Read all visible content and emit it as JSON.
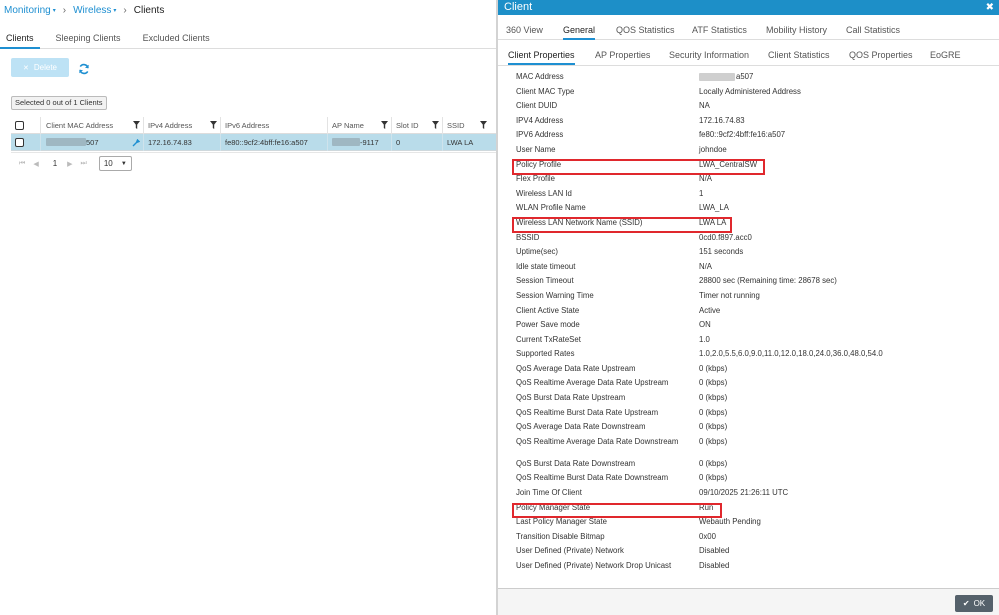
{
  "breadcrumb": {
    "monitoring": "Monitoring",
    "wireless": "Wireless",
    "current": "Clients"
  },
  "left_tabs": [
    "Clients",
    "Sleeping Clients",
    "Excluded Clients"
  ],
  "toolbar": {
    "delete_label": "Delete"
  },
  "selection": {
    "text": "Selected 0 out of 1 Clients"
  },
  "grid": {
    "headers": [
      "Client MAC Address",
      "IPv4 Address",
      "IPv6 Address",
      "AP Name",
      "Slot ID",
      "SSID"
    ],
    "row": {
      "mac_suffix": "507",
      "ipv4": "172.16.74.83",
      "ipv6": "fe80::9cf2:4bff:fe16:a507",
      "ap_suffix": "-9117",
      "slot": "0",
      "ssid": "LWA LA"
    }
  },
  "pager": {
    "page": "1",
    "per_page": "10"
  },
  "panel": {
    "title": "Client",
    "tabs": [
      "360 View",
      "General",
      "QOS Statistics",
      "ATF Statistics",
      "Mobility History",
      "Call Statistics"
    ],
    "active_tab": "General",
    "subtabs": [
      "Client Properties",
      "AP Properties",
      "Security Information",
      "Client Statistics",
      "QOS Properties",
      "EoGRE"
    ],
    "active_subtab": "Client Properties",
    "properties": [
      {
        "label": "MAC Address",
        "value": "a507"
      },
      {
        "label": "Client MAC Type",
        "value": "Locally Administered Address"
      },
      {
        "label": "Client DUID",
        "value": "NA"
      },
      {
        "label": "IPV4 Address",
        "value": "172.16.74.83"
      },
      {
        "label": "IPV6 Address",
        "value": "fe80::9cf2:4bff:fe16:a507"
      },
      {
        "label": "User Name",
        "value": "johndoe"
      },
      {
        "label": "Policy Profile",
        "value": "LWA_CentralSW"
      },
      {
        "label": "Flex Profile",
        "value": "N/A"
      },
      {
        "label": "Wireless LAN Id",
        "value": "1"
      },
      {
        "label": "WLAN Profile Name",
        "value": "LWA_LA"
      },
      {
        "label": "Wireless LAN Network Name (SSID)",
        "value": "LWA LA"
      },
      {
        "label": "BSSID",
        "value": "0cd0.f897.acc0"
      },
      {
        "label": "Uptime(sec)",
        "value": "151 seconds"
      },
      {
        "label": "Idle state timeout",
        "value": "N/A"
      },
      {
        "label": "Session Timeout",
        "value": "28800 sec (Remaining time: 28678 sec)"
      },
      {
        "label": "Session Warning Time",
        "value": "Timer not running"
      },
      {
        "label": "Client Active State",
        "value": "Active"
      },
      {
        "label": "Power Save mode",
        "value": "ON"
      },
      {
        "label": "Current TxRateSet",
        "value": "1.0"
      },
      {
        "label": "Supported Rates",
        "value": "1.0,2.0,5.5,6.0,9.0,11.0,12.0,18.0,24.0,36.0,48.0,54.0"
      },
      {
        "label": "QoS Average Data Rate Upstream",
        "value": "0 (kbps)"
      },
      {
        "label": "QoS Realtime Average Data Rate Upstream",
        "value": "0 (kbps)"
      },
      {
        "label": "QoS Burst Data Rate Upstream",
        "value": "0 (kbps)"
      },
      {
        "label": "QoS Realtime Burst Data Rate Upstream",
        "value": "0 (kbps)"
      },
      {
        "label": "QoS Average Data Rate Downstream",
        "value": "0 (kbps)"
      },
      {
        "label": "QoS Realtime Average Data Rate Downstream",
        "value": "0 (kbps)"
      },
      {
        "label": "QoS Burst Data Rate Downstream",
        "value": "0 (kbps)"
      },
      {
        "label": "QoS Realtime Burst Data Rate Downstream",
        "value": "0 (kbps)"
      },
      {
        "label": "Join Time Of Client",
        "value": "09/10/2025 21:26:11 UTC"
      },
      {
        "label": "Policy Manager State",
        "value": "Run"
      },
      {
        "label": "Last Policy Manager State",
        "value": "Webauth Pending"
      },
      {
        "label": "Transition Disable Bitmap",
        "value": "0x00"
      },
      {
        "label": "User Defined (Private) Network",
        "value": "Disabled"
      },
      {
        "label": "User Defined (Private) Network Drop Unicast",
        "value": "Disabled"
      }
    ],
    "ok_label": "OK"
  },
  "colors": {
    "accent": "#1d8fc8",
    "highlight": "#e0282d",
    "row_selected": "#b9dcea"
  }
}
